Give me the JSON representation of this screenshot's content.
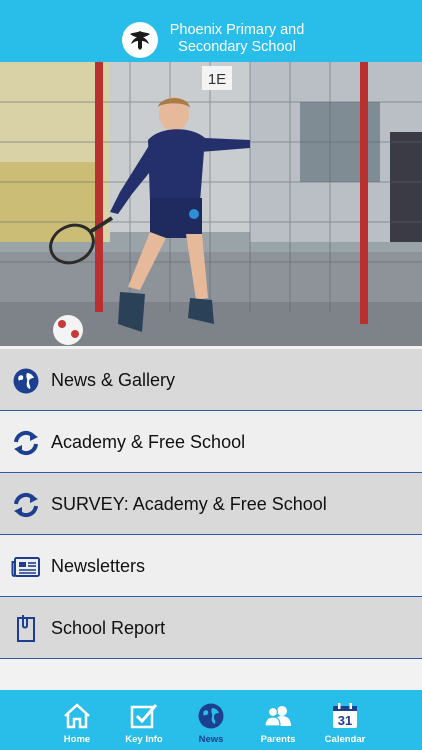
{
  "header": {
    "title_line1": "Phoenix Primary and",
    "title_line2": "Secondary School",
    "logo_icon": "phoenix-crest-icon"
  },
  "hero": {
    "sign_text": "1E"
  },
  "menu": {
    "items": [
      {
        "label": "News & Gallery",
        "icon": "globe-icon"
      },
      {
        "label": "Academy & Free School",
        "icon": "refresh-icon"
      },
      {
        "label": "SURVEY: Academy & Free School",
        "icon": "refresh-icon"
      },
      {
        "label": "Newsletters",
        "icon": "newspaper-icon"
      },
      {
        "label": "School Report",
        "icon": "clipboard-icon"
      }
    ]
  },
  "tabbar": {
    "active": "News",
    "tabs": [
      {
        "label": "Home",
        "icon": "house-icon"
      },
      {
        "label": "Key Info",
        "icon": "checkbox-icon"
      },
      {
        "label": "News",
        "icon": "globe-icon"
      },
      {
        "label": "Parents",
        "icon": "people-icon"
      },
      {
        "label": "Calendar",
        "icon": "calendar-icon",
        "day": "31"
      }
    ]
  },
  "colors": {
    "header_bg": "#29bde9",
    "menu_divider": "#2e5aa8",
    "icon_blue": "#1c3f8f",
    "menu_row_dark": "#d9d9d9",
    "menu_row_light": "#efefef"
  }
}
